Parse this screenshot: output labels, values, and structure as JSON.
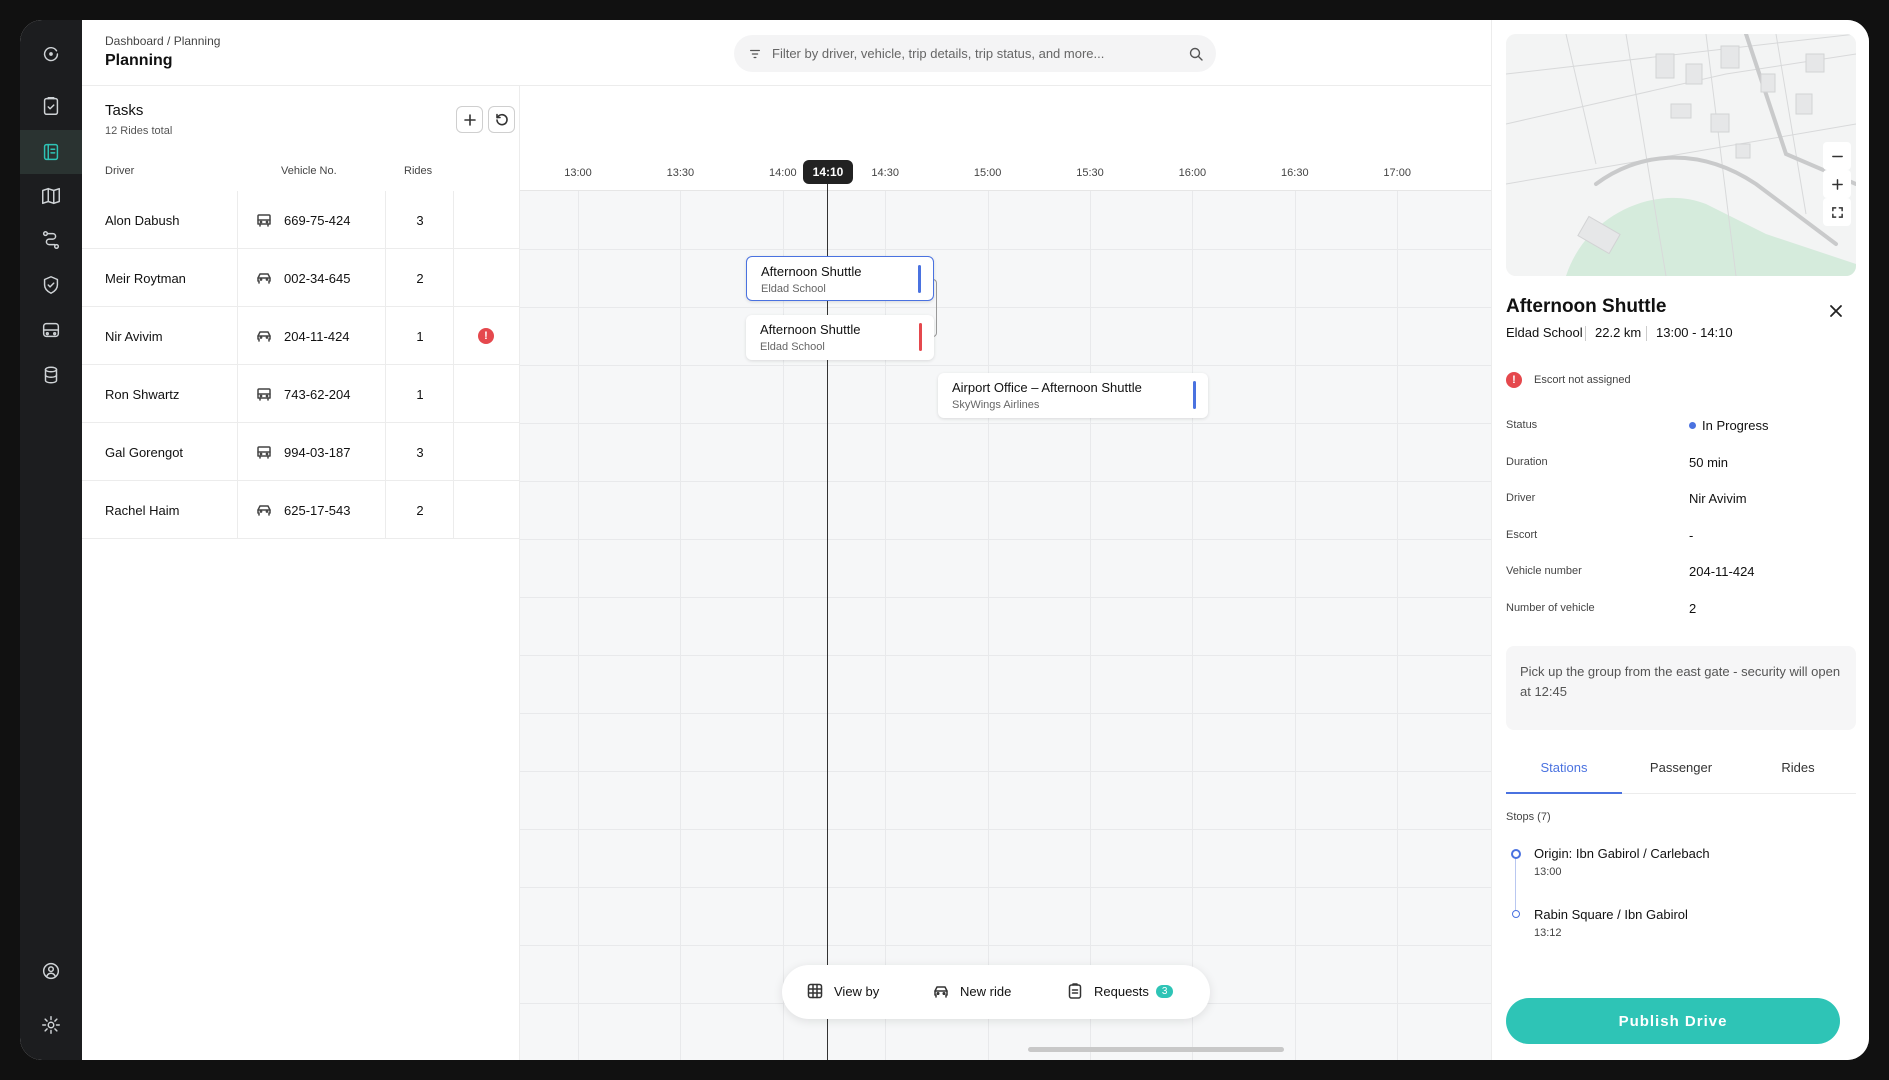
{
  "header": {
    "breadcrumb": "Dashboard  /  Planning",
    "title": "Planning",
    "search_placeholder": "Filter by driver, vehicle, trip details, trip status, and more..."
  },
  "nav": {
    "icons": [
      "logo-icon",
      "clipboard-icon",
      "planning-icon",
      "map-icon",
      "routes-icon",
      "shield-icon",
      "vehicle-icon",
      "database-icon",
      "profile-icon",
      "settings-icon"
    ],
    "active": "planning-icon",
    "accent_color": "#2ec4b6"
  },
  "tasks": {
    "title": "Tasks",
    "subtitle": "12 Rides total",
    "columns": {
      "driver": "Driver",
      "vehicle": "Vehicle No.",
      "rides": "Rides"
    },
    "rows": [
      {
        "driver": "Alon Dabush",
        "vehicle_type": "bus",
        "vehicle": "669-75-424",
        "rides": "3",
        "alert": false
      },
      {
        "driver": "Meir Roytman",
        "vehicle_type": "car",
        "vehicle": "002-34-645",
        "rides": "2",
        "alert": false
      },
      {
        "driver": "Nir Avivim",
        "vehicle_type": "car",
        "vehicle": "204-11-424",
        "rides": "1",
        "alert": true
      },
      {
        "driver": "Ron Shwartz",
        "vehicle_type": "bus",
        "vehicle": "743-62-204",
        "rides": "1",
        "alert": false
      },
      {
        "driver": "Gal Gorengot",
        "vehicle_type": "bus",
        "vehicle": "994-03-187",
        "rides": "3",
        "alert": false
      },
      {
        "driver": "Rachel Haim",
        "vehicle_type": "car",
        "vehicle": "625-17-543",
        "rides": "2",
        "alert": false
      }
    ]
  },
  "timeline": {
    "ticks": [
      "13:00",
      "13:30",
      "14:00",
      "14:30",
      "15:00",
      "15:30",
      "16:00",
      "16:30",
      "17:00"
    ],
    "current_time": "14:10",
    "cards": [
      {
        "title": "Afternoon Shuttle",
        "subtitle": "Eldad School",
        "bar_color": "#4a72e0",
        "selected": true
      },
      {
        "title": "Afternoon Shuttle",
        "subtitle": "Eldad School",
        "bar_color": "#e5484d",
        "selected": false
      },
      {
        "title": "Airport Office – Afternoon Shuttle",
        "subtitle": "SkyWings Airlines",
        "bar_color": "#4a72e0",
        "selected": false
      }
    ]
  },
  "toolbar": {
    "view_by": "View by",
    "new_ride": "New ride",
    "requests": "Requests",
    "requests_count": "3"
  },
  "panel": {
    "title": "Afternoon Shuttle",
    "location": "Eldad School",
    "distance": "22.2 km",
    "time_range": "13:00 - 14:10",
    "warning": "Escort not assigned",
    "details": [
      {
        "label": "Status",
        "value": "In Progress"
      },
      {
        "label": "Duration",
        "value": "50 min"
      },
      {
        "label": "Driver",
        "value": "Nir Avivim"
      },
      {
        "label": "Escort",
        "value": "-"
      },
      {
        "label": "Vehicle number",
        "value": "204-11-424"
      },
      {
        "label": "Number of vehicle",
        "value": "2"
      }
    ],
    "note": "Pick up the group from the east gate - security will open at 12:45",
    "tabs": [
      "Stations",
      "Passenger",
      "Rides"
    ],
    "active_tab": "Stations",
    "stops_label": "Stops (7)",
    "stops": [
      {
        "name": "Origin: Ibn Gabirol / Carlebach",
        "time": "13:00"
      },
      {
        "name": "Rabin Square / Ibn Gabirol",
        "time": "13:12"
      }
    ],
    "publish_label": "Publish Drive"
  }
}
